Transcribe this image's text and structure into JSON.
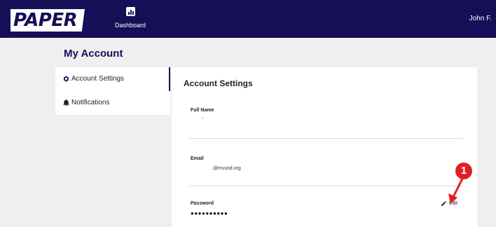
{
  "header": {
    "logo_text": "PAPER",
    "nav_dashboard_label": "Dashboard",
    "nav_dashboard_icon": "bar-chart-icon",
    "user_name": "John F."
  },
  "page": {
    "title": "My Account"
  },
  "sidebar": {
    "items": [
      {
        "label": "Account Settings",
        "icon": "gear-icon",
        "active": true
      },
      {
        "label": "Notifications",
        "icon": "bell-icon",
        "active": false
      }
    ]
  },
  "settings": {
    "title": "Account Settings",
    "full_name": {
      "label": "Full Name",
      "value": "-"
    },
    "email": {
      "label": "Email",
      "value": ".@mvusd.org"
    },
    "password": {
      "label": "Password",
      "value": "●●●●●●●●●●",
      "edit_label": "Edit",
      "edit_icon": "pencil-icon"
    }
  },
  "annotation": {
    "badge": "1",
    "color": "#e01e24"
  },
  "colors": {
    "brand": "#150f58",
    "background": "#efefef",
    "panel": "#ffffff"
  }
}
